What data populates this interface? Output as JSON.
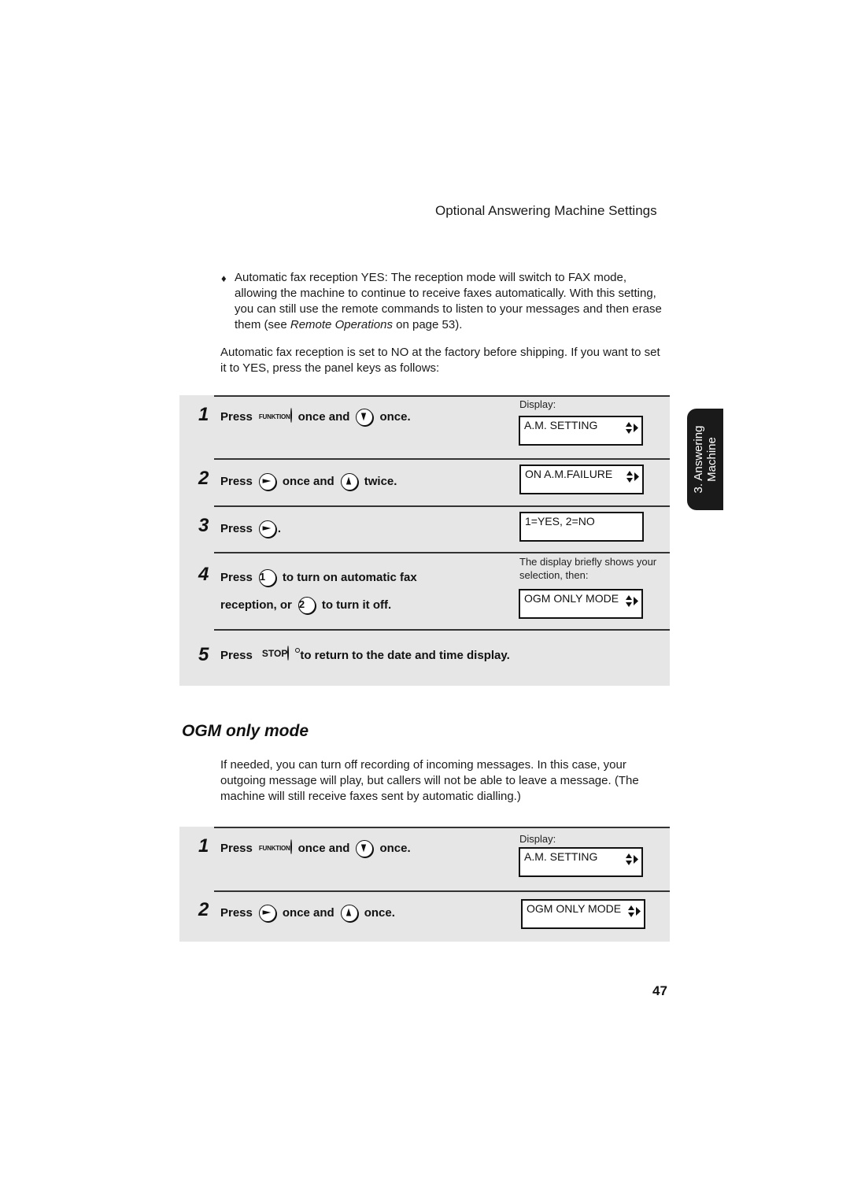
{
  "header": {
    "title": "Optional Answering Machine Settings"
  },
  "bullet": {
    "glyph": "♦",
    "text_before": "Automatic fax reception YES: The reception mode will switch to FAX mode, allowing the machine to continue to receive faxes automatically. With this setting, you can still use the remote commands to listen to your messages and then erase them (see ",
    "italic": "Remote Operations",
    "text_after": " on page 53)."
  },
  "intro": "Automatic fax reception is set to NO at the factory before shipping. If you want to set it to YES, press the panel keys as follows:",
  "procedure1": {
    "display_caption": "Display:",
    "steps": [
      {
        "num": "1",
        "press": "Press",
        "key1": "FUNKTION",
        "mid": "once and",
        "key2": "down-arrow",
        "end": "once.",
        "display": "A.M. SETTING"
      },
      {
        "num": "2",
        "press": "Press",
        "key1": "right-arrow",
        "mid": "once and",
        "key2": "up-arrow",
        "end": "twice.",
        "display": "ON A.M.FAILURE"
      },
      {
        "num": "3",
        "press": "Press",
        "key1": "right-arrow",
        "end": ".",
        "display": "1=YES, 2=NO"
      },
      {
        "num": "4",
        "press": "Press",
        "key1": "1",
        "line1_end": "to turn on automatic fax",
        "line2_start": "reception, or",
        "key2": "2",
        "line2_end": "to turn it off.",
        "note": "The display briefly shows your selection, then:",
        "display": "OGM ONLY MODE"
      },
      {
        "num": "5",
        "press": "Press",
        "key1": "STOP",
        "end": "to return to the date and time display."
      }
    ]
  },
  "section": {
    "title": "OGM only mode",
    "text": "If needed, you can turn off recording of incoming messages. In this case, your outgoing message will play, but callers will not be able to leave a message. (The machine will still receive faxes sent by automatic dialling.)"
  },
  "procedure2": {
    "display_caption": "Display:",
    "steps": [
      {
        "num": "1",
        "press": "Press",
        "key1": "FUNKTION",
        "mid": "once and",
        "key2": "down-arrow",
        "end": "once.",
        "display": "A.M. SETTING"
      },
      {
        "num": "2",
        "press": "Press",
        "key1": "right-arrow",
        "mid": "once and",
        "key2": "up-arrow",
        "end": "once.",
        "display": "OGM ONLY MODE"
      }
    ]
  },
  "thumb_tab": {
    "line1": "3. Answering",
    "line2": "Machine"
  },
  "page_number": "47"
}
